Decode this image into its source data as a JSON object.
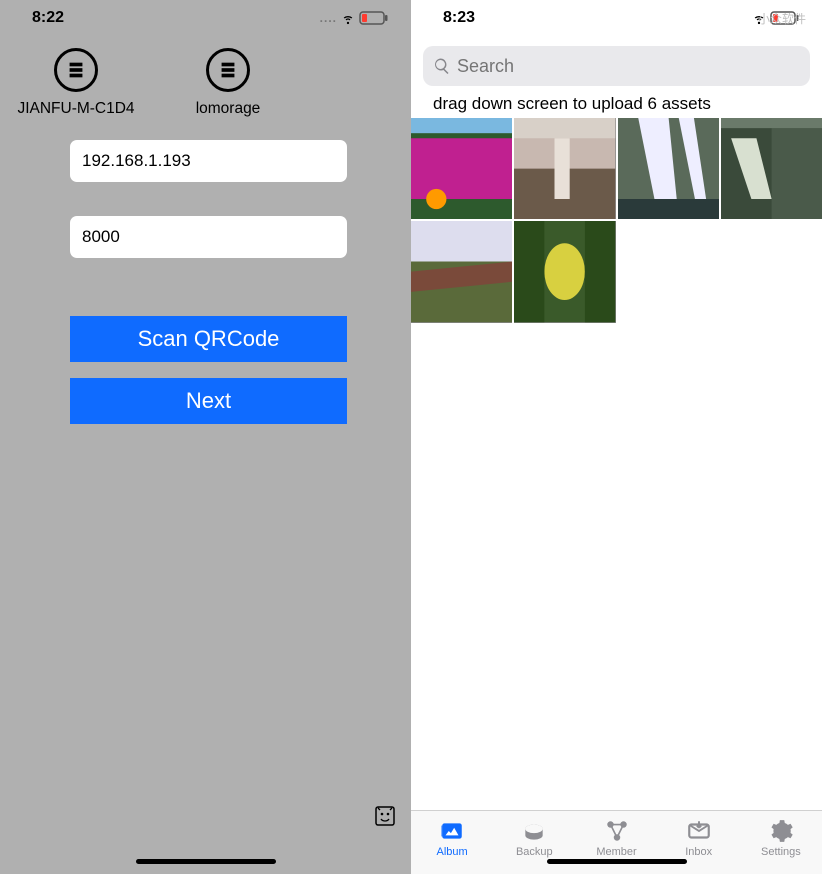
{
  "left": {
    "status": {
      "time": "8:22"
    },
    "servers": [
      {
        "label": "JIANFU-M-C1D4",
        "icon": "server-bars-icon"
      },
      {
        "label": "lomorage",
        "icon": "server-bars-icon"
      }
    ],
    "fields": {
      "host_value": "192.168.1.193",
      "port_value": "8000"
    },
    "buttons": {
      "scan_label": "Scan QRCode",
      "next_label": "Next"
    }
  },
  "right": {
    "status": {
      "time": "8:23"
    },
    "watermark": "小众软件",
    "search": {
      "placeholder": "Search"
    },
    "drag_hint": "drag down screen to upload 6 assets",
    "thumbs": [
      {
        "name": "pink-flowers"
      },
      {
        "name": "waterfall-canyon"
      },
      {
        "name": "white-waterfall"
      },
      {
        "name": "cataract-river"
      },
      {
        "name": "hillside-grass"
      },
      {
        "name": "yellow-leaf"
      }
    ],
    "tabs": [
      {
        "id": "album",
        "label": "Album",
        "icon": "album-icon",
        "active": true
      },
      {
        "id": "backup",
        "label": "Backup",
        "icon": "backup-icon",
        "active": false
      },
      {
        "id": "member",
        "label": "Member",
        "icon": "member-icon",
        "active": false
      },
      {
        "id": "inbox",
        "label": "Inbox",
        "icon": "inbox-icon",
        "active": false
      },
      {
        "id": "settings",
        "label": "Settings",
        "icon": "settings-icon",
        "active": false
      }
    ]
  }
}
